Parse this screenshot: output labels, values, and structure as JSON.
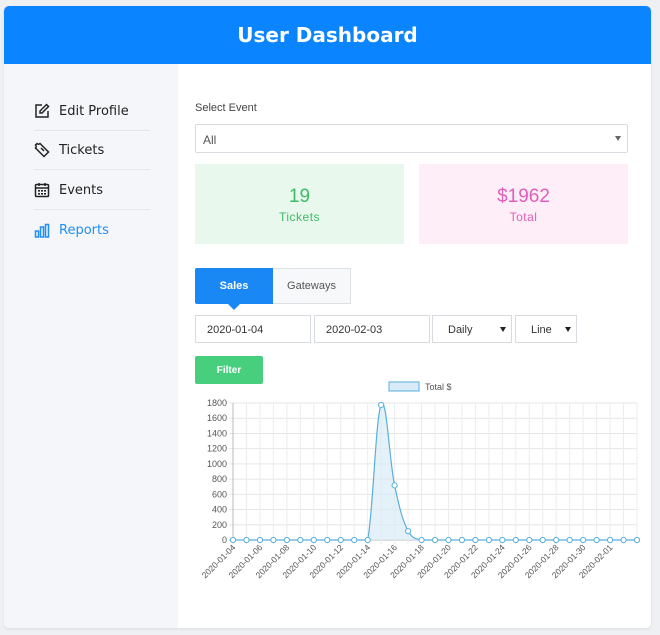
{
  "header": {
    "title": "User Dashboard"
  },
  "sidebar": {
    "items": [
      {
        "label": "Edit Profile",
        "icon": "edit-icon"
      },
      {
        "label": "Tickets",
        "icon": "ticket-icon"
      },
      {
        "label": "Events",
        "icon": "calendar-icon"
      },
      {
        "label": "Reports",
        "icon": "bar-chart-icon",
        "active": true
      }
    ]
  },
  "filters": {
    "event_label": "Select Event",
    "event_value": "All",
    "start_date": "2020-01-04",
    "end_date": "2020-02-03",
    "interval": "Daily",
    "chart_type": "Line",
    "filter_button": "Filter"
  },
  "cards": {
    "tickets": {
      "value": "19",
      "label": "Tickets"
    },
    "total": {
      "value": "$1962",
      "label": "Total"
    }
  },
  "tabs": [
    {
      "label": "Sales",
      "active": true
    },
    {
      "label": "Gateways"
    }
  ],
  "colors": {
    "header": "#0a84ff",
    "active_link": "#1f8ef5",
    "tickets_text": "#3dbb68",
    "total_text": "#e35dbb",
    "filter_button": "#48cf7e",
    "series_line": "#5aaedd",
    "series_fill": "#d8ebf7"
  },
  "chart_data": {
    "type": "line",
    "legend_position": "top",
    "grid": true,
    "ylim": [
      0,
      1800
    ],
    "yticks": [
      0,
      200,
      400,
      600,
      800,
      1000,
      1200,
      1400,
      1600,
      1800
    ],
    "x": [
      "2020-01-04",
      "2020-01-05",
      "2020-01-06",
      "2020-01-07",
      "2020-01-08",
      "2020-01-09",
      "2020-01-10",
      "2020-01-11",
      "2020-01-12",
      "2020-01-13",
      "2020-01-14",
      "2020-01-15",
      "2020-01-16",
      "2020-01-17",
      "2020-01-18",
      "2020-01-19",
      "2020-01-20",
      "2020-01-21",
      "2020-01-22",
      "2020-01-23",
      "2020-01-24",
      "2020-01-25",
      "2020-01-26",
      "2020-01-27",
      "2020-01-28",
      "2020-01-29",
      "2020-01-30",
      "2020-01-31",
      "2020-02-01",
      "2020-02-02",
      "2020-02-03"
    ],
    "xtick_labels": [
      "2020-01-04",
      "2020-01-06",
      "2020-01-08",
      "2020-01-10",
      "2020-01-12",
      "2020-01-14",
      "2020-01-16",
      "2020-01-18",
      "2020-01-20",
      "2020-01-22",
      "2020-01-24",
      "2020-01-26",
      "2020-01-28",
      "2020-01-30",
      "2020-02-01"
    ],
    "series": [
      {
        "name": "Total $",
        "values": [
          0,
          0,
          0,
          0,
          0,
          0,
          0,
          0,
          0,
          0,
          0,
          1774,
          718,
          116,
          0,
          0,
          0,
          0,
          0,
          0,
          0,
          0,
          0,
          0,
          0,
          0,
          0,
          0,
          0,
          0,
          0
        ]
      }
    ]
  }
}
